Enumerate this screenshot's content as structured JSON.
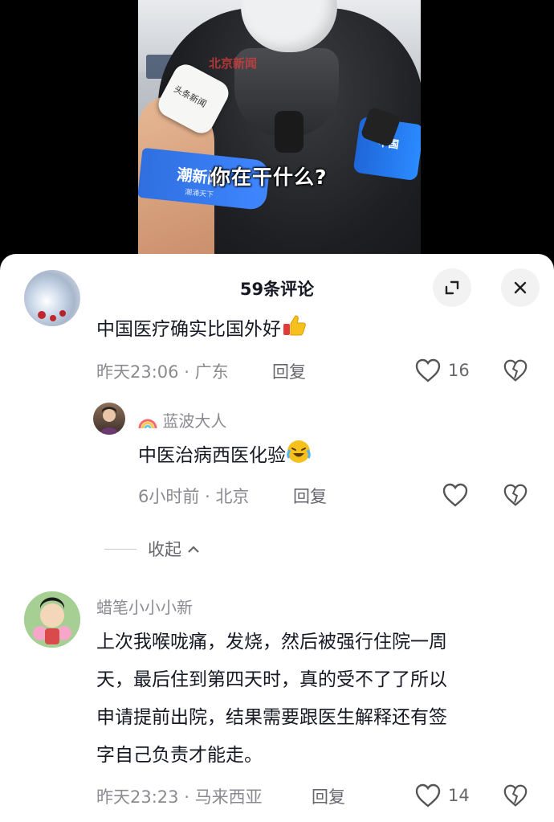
{
  "video": {
    "subtitle": "你在干什么?",
    "watermark": "北京新闻",
    "mic_logo": "头条新闻",
    "flag_text": "潮新闻",
    "flag_sub": "潮涌天下",
    "mic_right_text": "中国"
  },
  "panel": {
    "title": "59条评论",
    "expand_icon": "expand-icon",
    "close_icon": "close-icon"
  },
  "comments": [
    {
      "text": "中国医疗确实比国外好",
      "emoji": "thumbs-up-emoji",
      "time": "昨天23:06",
      "location": "广东",
      "reply_label": "回复",
      "likes": "16"
    },
    {
      "username": "蓝波大人",
      "username_prefix_icon": "rainbow-emoji",
      "text": "中医治病西医化验",
      "emoji": "crying-laughing-emoji",
      "time": "6小时前",
      "location": "北京",
      "reply_label": "回复",
      "likes": ""
    },
    {
      "username": "蜡笔小小小新",
      "text_lines": [
        "上次我喉咙痛，发烧，然后被强行住院一周",
        "天，最后住到第四天时，真的受不了了所以",
        "申请提前出院，结果需要跟医生解释还有签",
        "字自己负责才能走。"
      ],
      "time": "昨天23:23",
      "location": "马来西亚",
      "reply_label": "回复",
      "likes": "14"
    }
  ],
  "collapse": {
    "label": "收起"
  },
  "separator": "·",
  "colors": {
    "meta": "#8a8b91",
    "text": "#161823",
    "flag": "#2f6fe0"
  }
}
